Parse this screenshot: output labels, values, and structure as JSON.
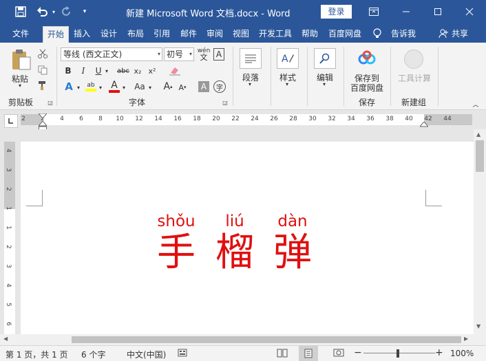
{
  "titlebar": {
    "title": "新建 Microsoft Word 文档.docx  -  Word",
    "login": "登录",
    "icons": [
      "save-icon",
      "undo-icon",
      "redo-icon",
      "customize-icon",
      "ribbon-display-icon",
      "minimize-icon",
      "maximize-icon",
      "close-icon"
    ]
  },
  "tabs": [
    "文件",
    "开始",
    "插入",
    "设计",
    "布局",
    "引用",
    "邮件",
    "审阅",
    "视图",
    "开发工具",
    "帮助",
    "百度网盘",
    "告诉我",
    "共享"
  ],
  "ribbon": {
    "clipboard": {
      "paste": "粘贴",
      "label": "剪贴板"
    },
    "font": {
      "family": "等线 (西文正文)",
      "size": "初号",
      "bold": "B",
      "italic": "I",
      "underline": "U",
      "strike": "abc",
      "sub": "x₂",
      "sup": "x²",
      "grow": "A",
      "shrink": "A",
      "case": "Aa",
      "clear": "A",
      "label": "字体"
    },
    "paragraph": {
      "label": "段落"
    },
    "styles": {
      "label": "样式"
    },
    "editing": {
      "label": "编辑"
    },
    "baidu": {
      "line1": "保存到",
      "line2": "百度网盘",
      "label": "保存"
    },
    "newgroup": {
      "tool": "工具计算",
      "label": "新建组"
    }
  },
  "ruler": {
    "labels": [
      "2",
      "2",
      "4",
      "6",
      "8",
      "10",
      "12",
      "14",
      "16",
      "18",
      "20",
      "22",
      "24",
      "26",
      "28",
      "30",
      "32",
      "34",
      "36",
      "38",
      "40",
      "42",
      "44"
    ],
    "vlabels": [
      "4",
      "3",
      "2",
      "1",
      "1",
      "2",
      "3",
      "4",
      "5",
      "6"
    ]
  },
  "document": {
    "pinyin": [
      "shǒu",
      "liú",
      "dàn"
    ],
    "hanzi": [
      "手",
      "榴",
      "弹"
    ],
    "color": "#e01010"
  },
  "status": {
    "page": "第 1 页，共 1 页",
    "words": "6 个字",
    "lang": "中文(中国)",
    "zoom": "100%"
  },
  "colors": {
    "brand": "#2b579a",
    "ribbon": "#f3f3f3"
  }
}
